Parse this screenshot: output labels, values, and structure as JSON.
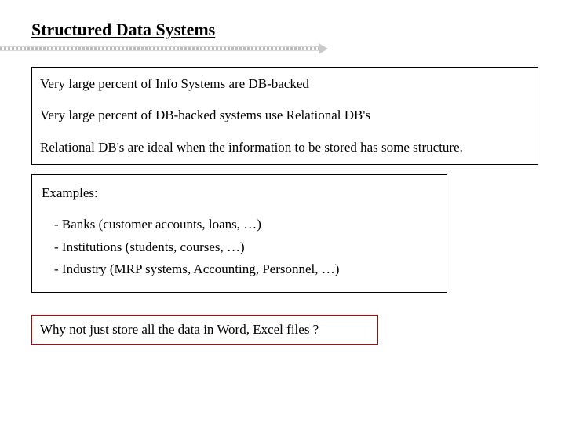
{
  "title": "Structured Data Systems",
  "points": {
    "p1": "Very large percent of Info Systems are DB-backed",
    "p2": "Very large percent of DB-backed systems use Relational DB's",
    "p3": "Relational DB's are ideal when the information to be stored has some structure."
  },
  "examples": {
    "label": "Examples:",
    "items": [
      "- Banks (customer accounts, loans, …)",
      "- Institutions (students, courses, …)",
      "- Industry (MRP systems, Accounting, Personnel, …)"
    ]
  },
  "question": "Why not just store all the data in Word, Excel files ?"
}
